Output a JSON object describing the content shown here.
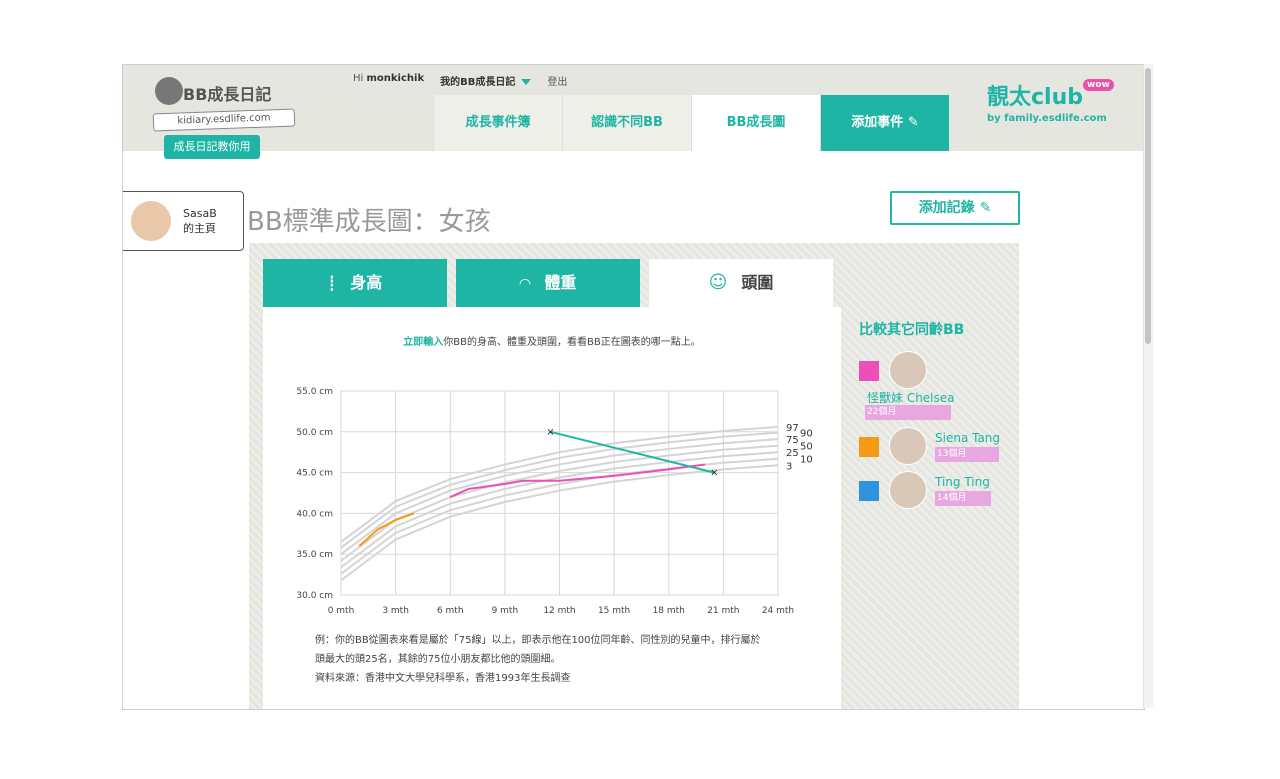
{
  "header": {
    "logo_title": "BB成長日記",
    "logo_url": "kidiary.esdlife.com",
    "guide_label": "成長日記教你用",
    "greeting": "Hi",
    "username": "monkichik",
    "my_diary": "我的BB成長日記",
    "logout": "登出",
    "tabs": [
      "成長事件簿",
      "認識不同BB",
      "BB成長圖",
      "添加事件"
    ],
    "brand_big": "靚太club",
    "brand_wow": "wow",
    "brand_small": "by family.esdlife.com"
  },
  "profile": {
    "name": "SasaB",
    "sub": "的主頁"
  },
  "page": {
    "title": "BB標準成長圖：女孩",
    "add_record": "添加記錄"
  },
  "chart_tabs": [
    "身高",
    "體重",
    "頭圍"
  ],
  "chart_intro": {
    "highlight": "立即輸入",
    "rest": "你BB的身高、體重及頭圍，看看BB正在圖表的哪一點上。"
  },
  "notes": [
    "例：你的BB從圖表來看是屬於「75線」以上，即表示他在100位同年齡、同性別的兒童中，排行屬於",
    "頭最大的頭25名，其餘的75位小朋友都比他的頭圍細。",
    "資料來源：香港中文大學兒科學系，香港1993年生長調查"
  ],
  "compare": {
    "title": "比較其它同齡BB",
    "items": [
      {
        "name": "怪獸妹 Chelsea",
        "age": "22個月",
        "color": "#ec4fb8"
      },
      {
        "name": "Siena Tang",
        "age": "13個月",
        "color": "#f39a16"
      },
      {
        "name": "Ting Ting",
        "age": "14個月",
        "color": "#2f94e0"
      }
    ]
  },
  "colors": {
    "accent": "#1fb5a5",
    "grid": "#d8d8d8",
    "percentile": "#d4d4d4"
  },
  "chart_data": {
    "type": "line",
    "xlabel": "",
    "ylabel": "",
    "x_ticks": [
      "0 mth",
      "3 mth",
      "6 mth",
      "9 mth",
      "12 mth",
      "15 mth",
      "18 mth",
      "21 mth",
      "24 mth"
    ],
    "y_ticks": [
      "30.0 cm",
      "35.0 cm",
      "40.0 cm",
      "45.0 cm",
      "50.0 cm",
      "55.0 cm"
    ],
    "xlim": [
      0,
      24
    ],
    "ylim": [
      30,
      55
    ],
    "percentile_labels": [
      "97",
      "90",
      "75",
      "50",
      "25",
      "10",
      "3"
    ],
    "percentiles": [
      {
        "name": "97",
        "x": [
          0,
          3,
          6,
          9,
          12,
          15,
          18,
          21,
          24
        ],
        "y": [
          36.5,
          41.5,
          44.2,
          46.0,
          47.5,
          48.6,
          49.4,
          50.1,
          50.6
        ]
      },
      {
        "name": "90",
        "x": [
          0,
          3,
          6,
          9,
          12,
          15,
          18,
          21,
          24
        ],
        "y": [
          35.8,
          40.8,
          43.5,
          45.3,
          46.8,
          47.9,
          48.7,
          49.4,
          49.9
        ]
      },
      {
        "name": "75",
        "x": [
          0,
          3,
          6,
          9,
          12,
          15,
          18,
          21,
          24
        ],
        "y": [
          35.0,
          40.0,
          42.8,
          44.6,
          46.0,
          47.1,
          47.9,
          48.6,
          49.1
        ]
      },
      {
        "name": "50",
        "x": [
          0,
          3,
          6,
          9,
          12,
          15,
          18,
          21,
          24
        ],
        "y": [
          34.2,
          39.2,
          42.0,
          43.8,
          45.2,
          46.3,
          47.1,
          47.8,
          48.3
        ]
      },
      {
        "name": "25",
        "x": [
          0,
          3,
          6,
          9,
          12,
          15,
          18,
          21,
          24
        ],
        "y": [
          33.4,
          38.4,
          41.2,
          43.0,
          44.4,
          45.5,
          46.3,
          47.0,
          47.5
        ]
      },
      {
        "name": "10",
        "x": [
          0,
          3,
          6,
          9,
          12,
          15,
          18,
          21,
          24
        ],
        "y": [
          32.6,
          37.6,
          40.4,
          42.2,
          43.6,
          44.7,
          45.5,
          46.2,
          46.7
        ]
      },
      {
        "name": "3",
        "x": [
          0,
          3,
          6,
          9,
          12,
          15,
          18,
          21,
          24
        ],
        "y": [
          31.8,
          36.8,
          39.6,
          41.4,
          42.8,
          43.9,
          44.7,
          45.4,
          45.9
        ]
      }
    ],
    "series": [
      {
        "color": "#f39a16",
        "x": [
          1,
          2,
          3,
          4
        ],
        "y": [
          36,
          38,
          39.2,
          40
        ]
      },
      {
        "color": "#ec4fb8",
        "x": [
          6,
          7,
          9,
          10,
          12,
          15,
          18,
          20
        ],
        "y": [
          42,
          43,
          43.6,
          44,
          44,
          44.6,
          45.4,
          46
        ]
      },
      {
        "color": "#1fb5a5",
        "x": [
          11.5,
          20.5
        ],
        "y": [
          50,
          45
        ],
        "markers": true
      }
    ]
  }
}
